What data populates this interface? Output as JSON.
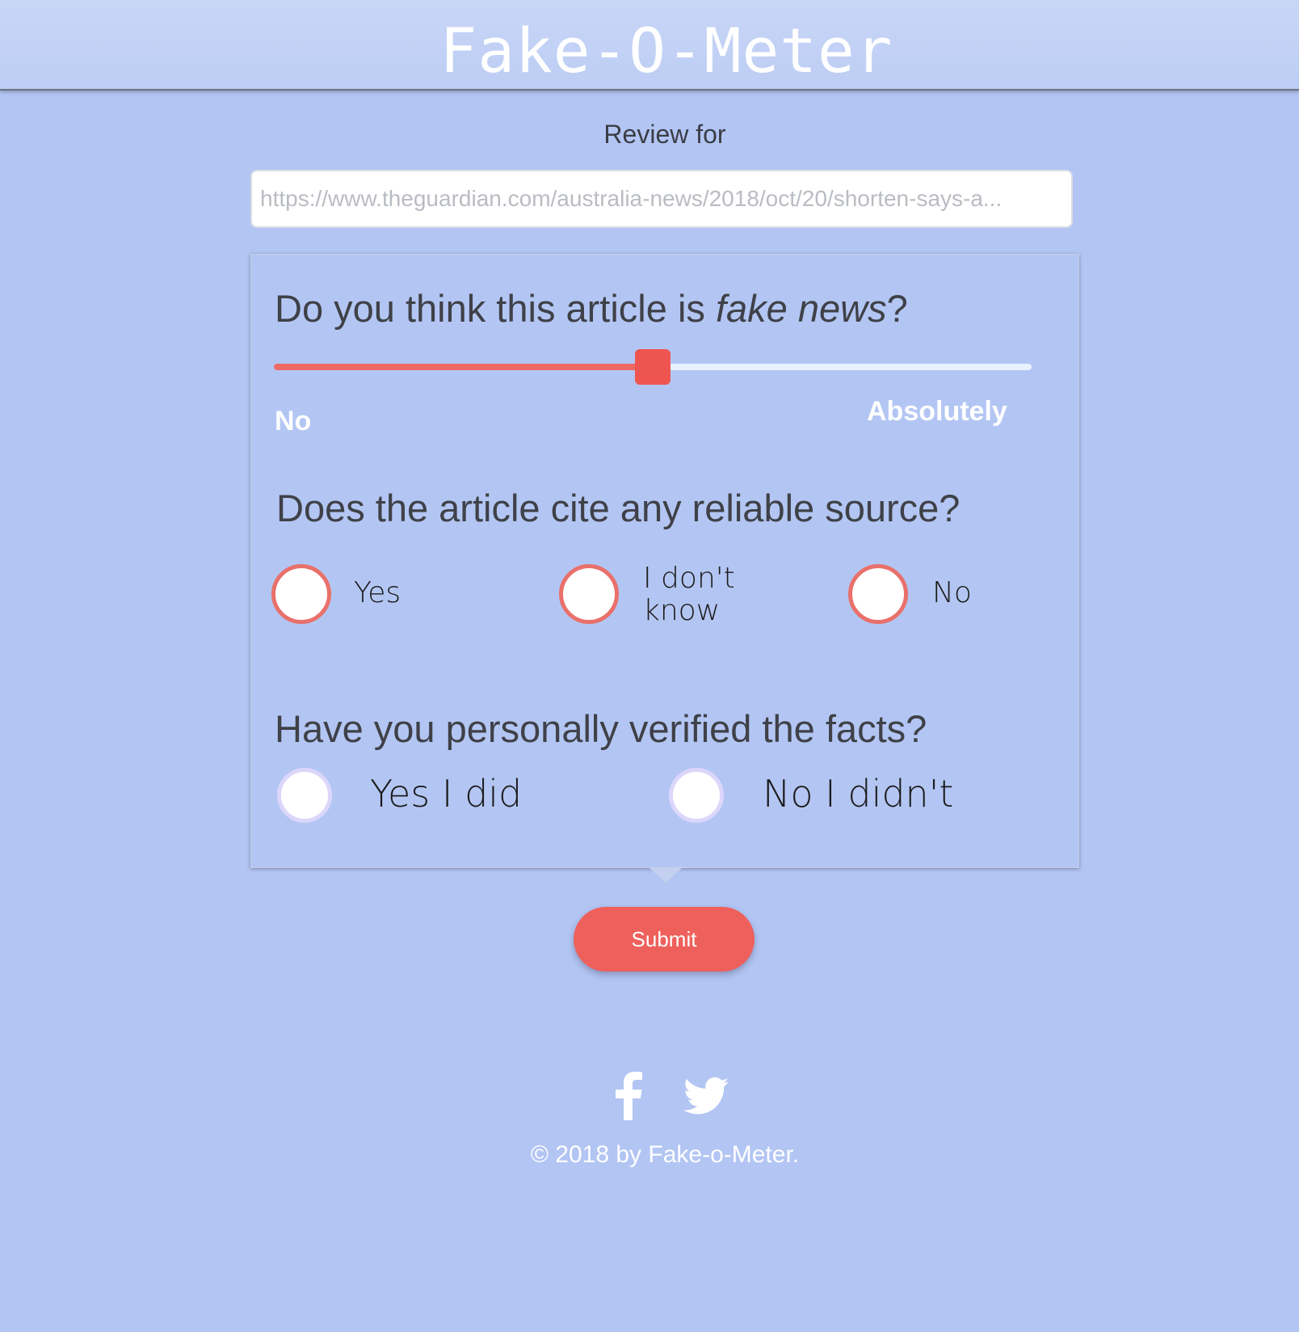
{
  "header": {
    "title": "Fake-O-Meter"
  },
  "review": {
    "label": "Review for",
    "url_placeholder": "https://www.theguardian.com/australia-news/2018/oct/20/shorten-says-a..."
  },
  "questions": {
    "fake_news": {
      "prefix": "Do you think this article is ",
      "emphasis": "fake news",
      "suffix": "?",
      "slider": {
        "value_fraction": 0.5,
        "min_label": "No",
        "max_label": "Absolutely"
      }
    },
    "reliable_source": {
      "text": "Does the article cite any reliable source?",
      "options": [
        "Yes",
        "I don't know",
        "No"
      ]
    },
    "verified": {
      "text": "Have you personally verified the facts?",
      "options": [
        "Yes I did",
        "No I didn't"
      ]
    }
  },
  "submit": {
    "label": "Submit"
  },
  "footer": {
    "copyright": "© 2018 by Fake-o-Meter.",
    "social": [
      "facebook-icon",
      "twitter-icon"
    ]
  },
  "colors": {
    "background": "#b2c5f3",
    "accent": "#ee605b",
    "slider_fill": "#ee6a66",
    "slider_track": "#e8f2ff",
    "radio_ring_red": "#e9706b",
    "radio_ring_lavender": "#dcd6fb"
  }
}
